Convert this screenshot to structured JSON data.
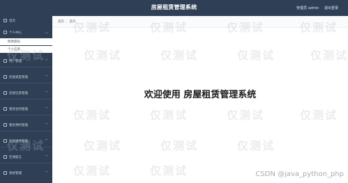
{
  "header": {
    "title": "房屋租赁管理系统",
    "user_label": "管理员 admin",
    "logout_label": "退出登录"
  },
  "sidebar": {
    "home": "首页",
    "personal_center": "个人中心",
    "sub_items": [
      "修改密码",
      "个人信息"
    ],
    "items": [
      "用户管理",
      "房屋类型管理",
      "房屋信息管理",
      "租赁合同管理",
      "看房预约管理",
      "房屋维修管理",
      "在线留言",
      "系统管理"
    ]
  },
  "breadcrumb": {
    "home": "首页",
    "current": "首页"
  },
  "main": {
    "welcome_text": "欢迎使用 房屋租赁管理系统"
  },
  "watermark": {
    "text": "仅测试",
    "credit": "CSDN @java_python_php"
  },
  "colors": {
    "sidebar_bg": "#2f4056",
    "accent": "#1e9fff"
  }
}
